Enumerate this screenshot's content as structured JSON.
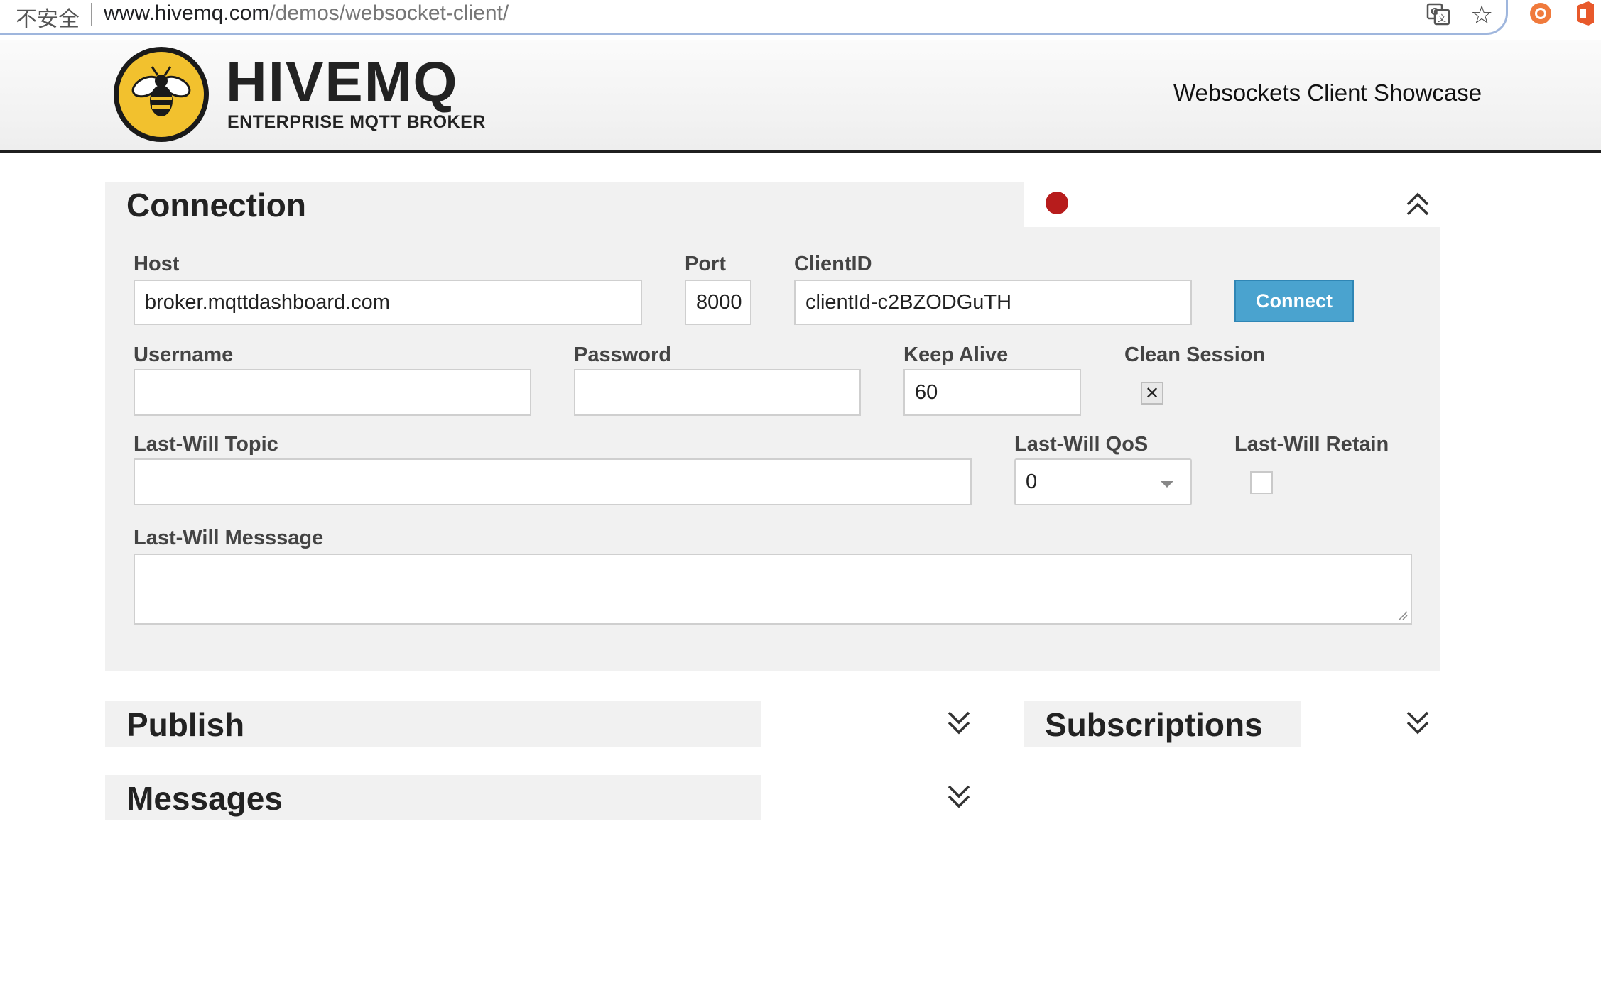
{
  "browser": {
    "security_label": "不安全",
    "url_host": "www.hivemq.com",
    "url_path": "/demos/websocket-client/"
  },
  "header": {
    "logo_text": "HIVEMQ",
    "logo_subtext": "ENTERPRISE MQTT BROKER",
    "title": "Websockets Client Showcase"
  },
  "connection": {
    "title": "Connection",
    "status": "disconnected",
    "status_color": "#b71c1c",
    "fields": {
      "host": {
        "label": "Host",
        "value": "broker.mqttdashboard.com"
      },
      "port": {
        "label": "Port",
        "value": "8000"
      },
      "client_id": {
        "label": "ClientID",
        "value": "clientId-c2BZODGuTH"
      },
      "username": {
        "label": "Username",
        "value": ""
      },
      "password": {
        "label": "Password",
        "value": ""
      },
      "keep_alive": {
        "label": "Keep Alive",
        "value": "60"
      },
      "clean_session": {
        "label": "Clean Session",
        "checked_mark": "✕"
      },
      "lw_topic": {
        "label": "Last-Will Topic",
        "value": ""
      },
      "lw_qos": {
        "label": "Last-Will QoS",
        "value": "0"
      },
      "lw_retain": {
        "label": "Last-Will Retain",
        "checked_mark": ""
      },
      "lw_message": {
        "label": "Last-Will Messsage",
        "value": ""
      }
    },
    "connect_label": "Connect"
  },
  "publish": {
    "title": "Publish"
  },
  "subscriptions": {
    "title": "Subscriptions"
  },
  "messages": {
    "title": "Messages"
  },
  "colors": {
    "accent_button": "#4aa3cf",
    "panel_bg": "#f1f1f1",
    "logo_yellow": "#f2c12e"
  }
}
